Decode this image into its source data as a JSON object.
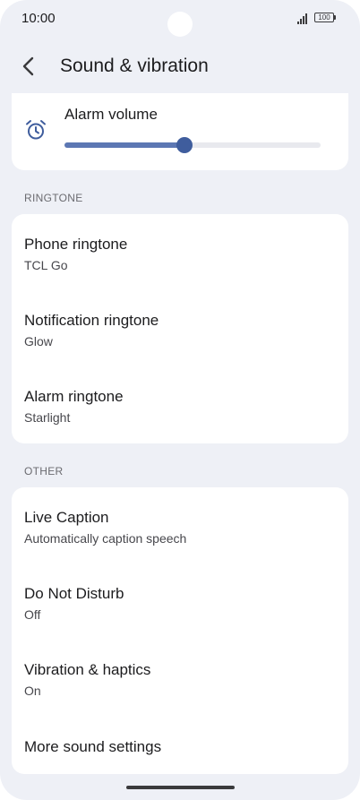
{
  "status_bar": {
    "time": "10:00",
    "battery": "100"
  },
  "header": {
    "title": "Sound & vibration"
  },
  "alarm_volume": {
    "label": "Alarm volume",
    "value_fraction": 0.47
  },
  "ringtone_section": {
    "header": "RINGTONE",
    "items": [
      {
        "title": "Phone ringtone",
        "subtitle": "TCL Go"
      },
      {
        "title": "Notification ringtone",
        "subtitle": "Glow"
      },
      {
        "title": "Alarm ringtone",
        "subtitle": "Starlight"
      }
    ]
  },
  "other_section": {
    "header": "OTHER",
    "items": [
      {
        "title": "Live Caption",
        "subtitle": "Automatically caption speech"
      },
      {
        "title": "Do Not Disturb",
        "subtitle": "Off"
      },
      {
        "title": "Vibration & haptics",
        "subtitle": "On"
      },
      {
        "title": "More sound settings"
      }
    ]
  },
  "colors": {
    "accent": "#3f5d9d",
    "slider_fill": "#5c77b3",
    "background": "#eef0f6",
    "card": "#ffffff"
  }
}
